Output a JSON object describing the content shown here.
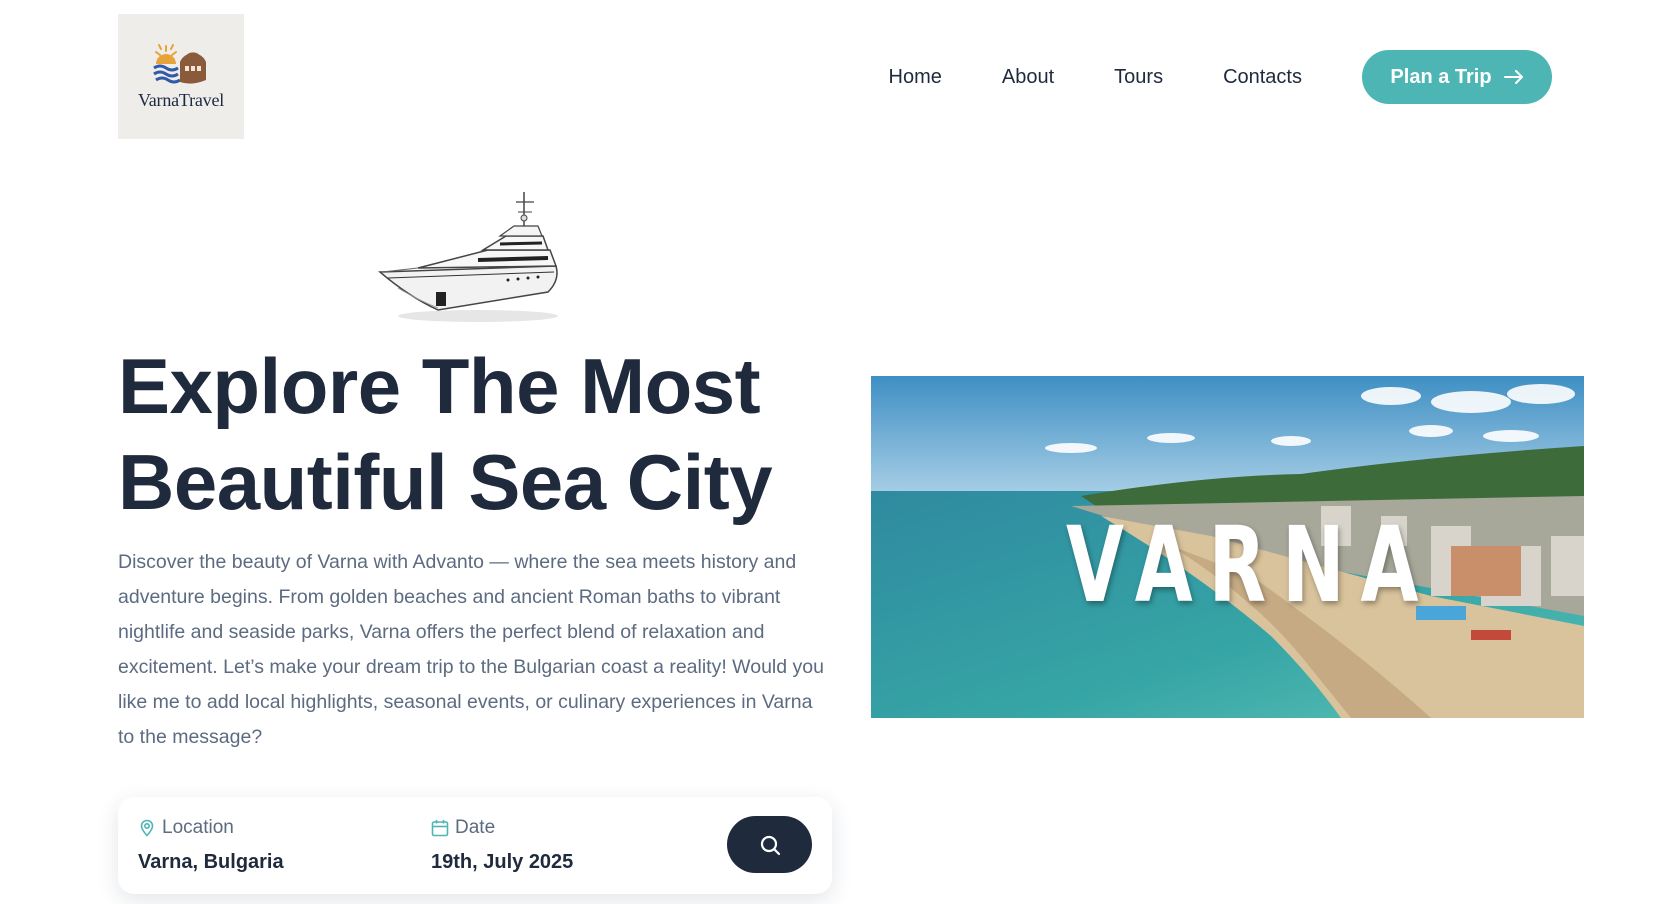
{
  "logo": {
    "text": "VarnaTravel",
    "icon": "sun-waves-house-icon"
  },
  "nav": {
    "items": [
      {
        "label": "Home"
      },
      {
        "label": "About"
      },
      {
        "label": "Tours"
      },
      {
        "label": "Contacts"
      }
    ],
    "cta_label": "Plan a Trip",
    "cta_icon": "arrow-right-icon"
  },
  "hero": {
    "title_line1": "Explore The Most",
    "title_line2": "Beautiful Sea City",
    "description": "Discover the beauty of Varna with Advanto — where the sea meets history and adventure begins. From golden beaches and ancient Roman baths to vibrant nightlife and seaside parks, Varna offers the perfect blend of relaxation and excitement. Let’s make your dream trip to the Bulgarian coast a reality! Would you like me to add local highlights, seasonal events, or culinary experiences in Varna to the message?",
    "image_caption": "VARNA"
  },
  "search": {
    "location_label": "Location",
    "location_value": "Varna, Bulgaria",
    "location_icon": "map-pin-icon",
    "date_label": "Date",
    "date_value": "19th, July 2025",
    "date_icon": "calendar-icon",
    "button_icon": "search-icon"
  },
  "colors": {
    "accent": "#4db6b4",
    "dark": "#1f2a3d",
    "muted_text": "#5c6b80",
    "logo_bg": "#efedea"
  }
}
